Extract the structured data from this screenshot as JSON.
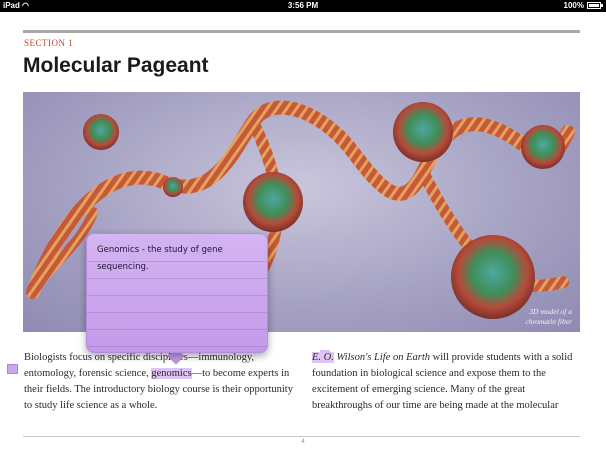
{
  "status_bar": {
    "carrier": "iPad",
    "time": "3:56 PM",
    "battery": "100%"
  },
  "section": {
    "label": "SECTION 1",
    "title": "Molecular Pageant"
  },
  "figure": {
    "caption": "3D model of a chromatin fiber"
  },
  "note": {
    "text": "Genomics - the study of gene sequencing."
  },
  "body_left": {
    "part1": "Biologists focus on specific disciplines—immunology, entomology, forensic science, ",
    "highlight": "genomics",
    "part2": "—to become experts in their fields. The introductory biology course is their opportunity to study life science as a whole."
  },
  "body_right": {
    "highlight": "E. O.",
    "italic": " Wilson's Life on Earth",
    "rest": " will provide students with a solid foundation in biological science and expose them to the excitement of emerging science. Many of the great breakthroughs of our time are being made at the molecular"
  },
  "page_number": "4",
  "colors": {
    "section_label": "#c9402a",
    "note_background": "#c39ae9",
    "highlight": "#e0c4f6"
  }
}
